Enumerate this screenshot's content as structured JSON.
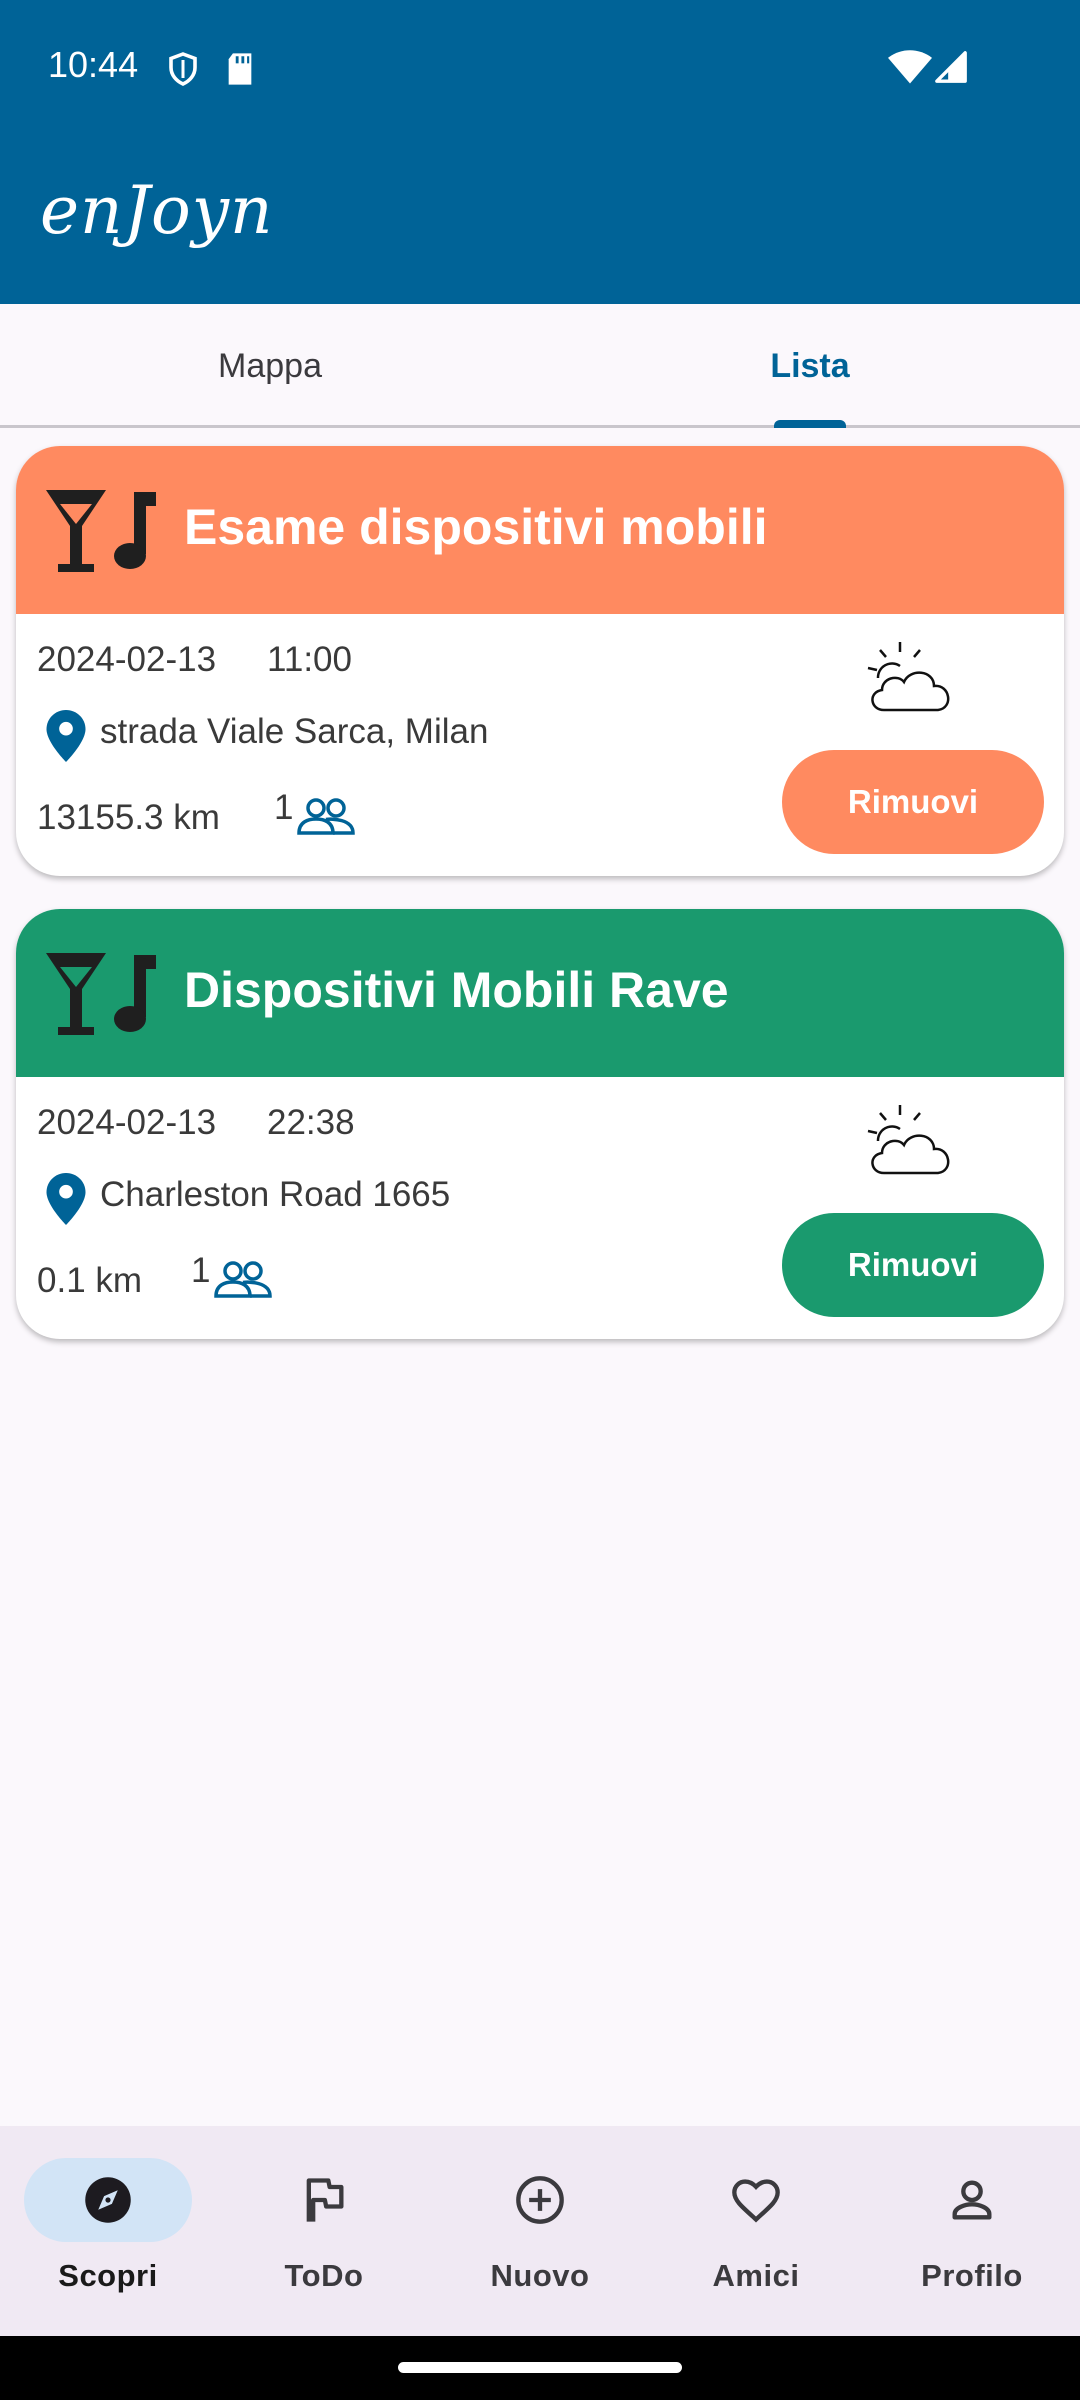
{
  "status_bar": {
    "time": "10:44"
  },
  "app": {
    "logo_text": "enJoyn"
  },
  "tabs": [
    {
      "label": "Mappa",
      "active": false
    },
    {
      "label": "Lista",
      "active": true
    }
  ],
  "events": [
    {
      "title": "Esame dispositivi mobili",
      "date": "2024-02-13",
      "time": "11:00",
      "location": "strada Viale Sarca, Milan",
      "distance": "13155.3 km",
      "participants": "1",
      "weather_icon": "partly-cloudy-icon",
      "category_icon": "cocktail-music-icon",
      "button_label": "Rimuovi",
      "color": "#ff8a60"
    },
    {
      "title": "Dispositivi Mobili Rave",
      "date": "2024-02-13",
      "time": "22:38",
      "location": "Charleston Road 1665",
      "distance": "0.1 km",
      "participants": "1",
      "weather_icon": "partly-cloudy-icon",
      "category_icon": "cocktail-music-icon",
      "button_label": "Rimuovi",
      "color": "#1a9a6e"
    }
  ],
  "bottom_nav": [
    {
      "label": "Scopri",
      "icon": "compass-icon",
      "active": true
    },
    {
      "label": "ToDo",
      "icon": "flag-icon",
      "active": false
    },
    {
      "label": "Nuovo",
      "icon": "add-circle-icon",
      "active": false
    },
    {
      "label": "Amici",
      "icon": "heart-icon",
      "active": false
    },
    {
      "label": "Profilo",
      "icon": "person-icon",
      "active": false
    }
  ],
  "colors": {
    "primary": "#006397",
    "background": "#fbf8fc",
    "nav_background": "#f0e9f3",
    "nav_active_pill": "#d2e4f6"
  }
}
